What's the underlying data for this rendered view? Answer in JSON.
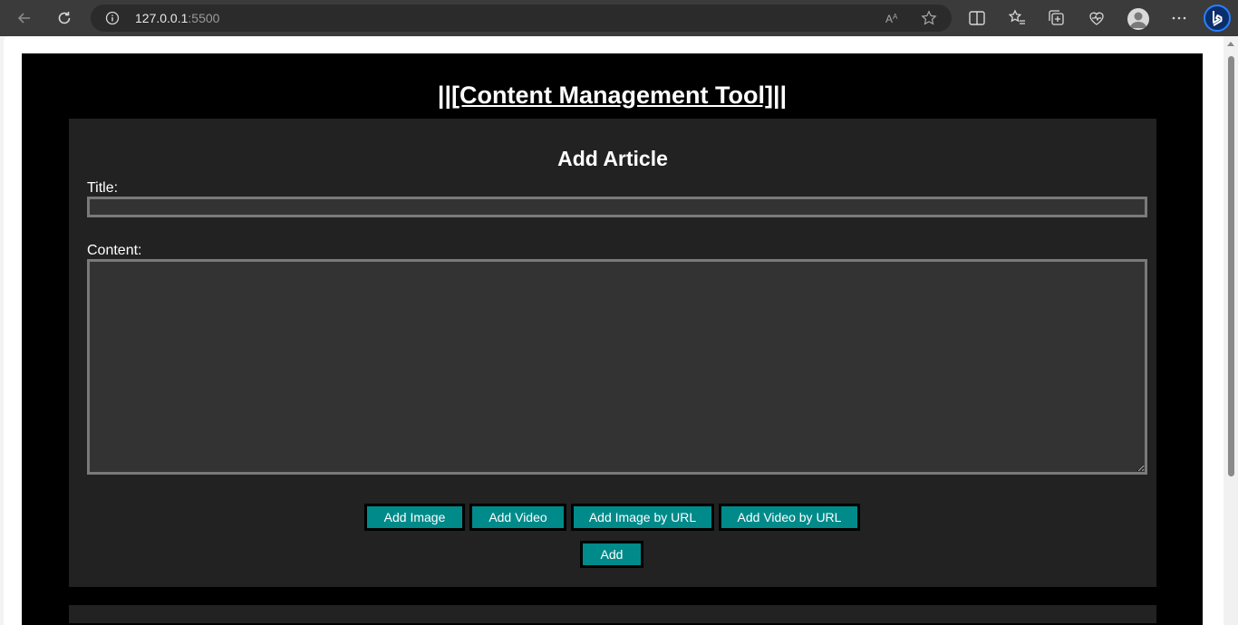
{
  "browser": {
    "url_host": "127.0.0.1",
    "url_port": ":5500"
  },
  "page": {
    "title_prefix": "||",
    "title_link": "[Content Management Tool]",
    "title_suffix": "||"
  },
  "form": {
    "heading": "Add Article",
    "title_label": "Title:",
    "title_value": "",
    "content_label": "Content:",
    "content_value": "",
    "buttons": {
      "add_image": "Add Image",
      "add_video": "Add Video",
      "add_image_url": "Add Image by URL",
      "add_video_url": "Add Video by URL",
      "add": "Add"
    }
  },
  "colors": {
    "page_bg": "#000000",
    "panel_bg": "#222222",
    "button_bg": "#008a8a",
    "input_bg": "#333333"
  }
}
